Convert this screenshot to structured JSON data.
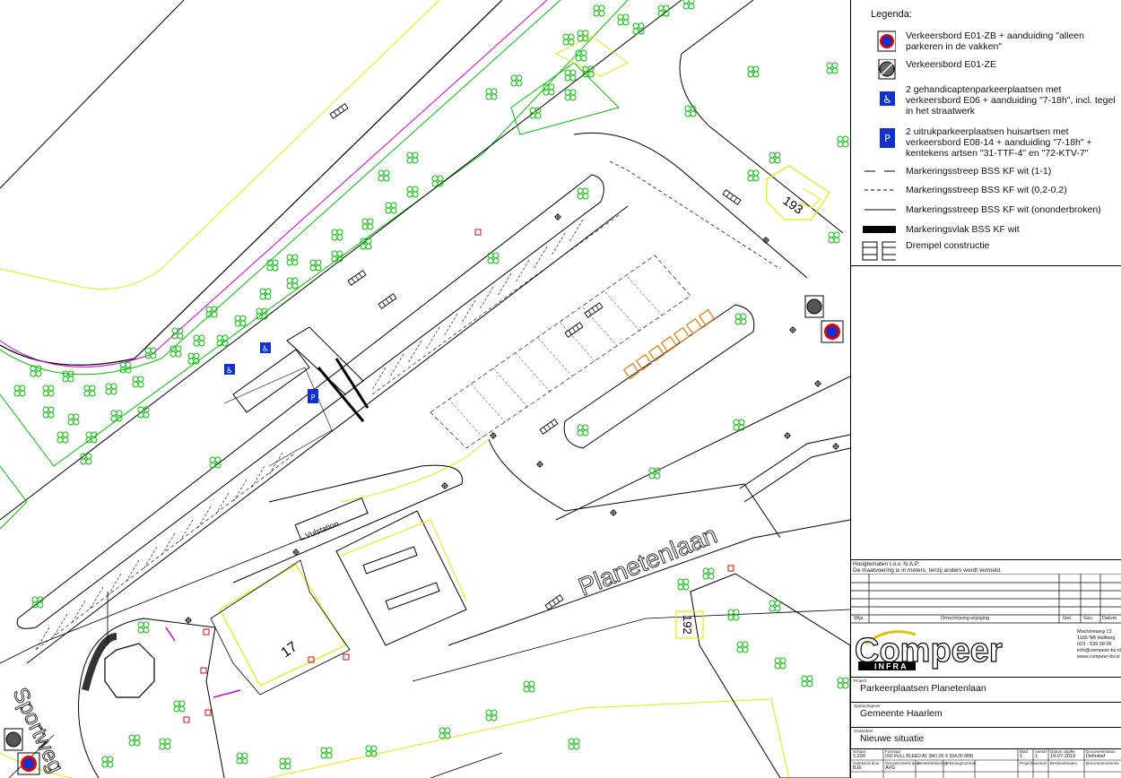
{
  "map": {
    "streets": [
      "Planetenlaan",
      "Sportweg"
    ],
    "labels": {
      "vulstation": "Vulstation",
      "house_17": "17",
      "house_192": "192",
      "house_193": "193"
    }
  },
  "legend": {
    "title": "Legenda:",
    "items": [
      {
        "icon": "no-parking-sign-icon",
        "text": "Verkeersbord E01-ZB + aanduiding \"alleen parkeren in de vakken\""
      },
      {
        "icon": "end-no-parking-sign-icon",
        "text": "Verkeersbord E01-ZE"
      },
      {
        "icon": "disabled-parking-sign-icon",
        "text": "2 gehandicaptenparkeerplaatsen met verkeersbord E06 + aanduiding \"7-18h\", incl. tegel in het straatwerk"
      },
      {
        "icon": "doctor-parking-sign-icon",
        "text": "2 uitrukparkeerplaatsen huisartsen met verkeersbord E08-14 + aanduiding \"7-18h\" + kentekens artsen \"31-TTF-4\" en \"72-KTV-7\""
      },
      {
        "icon": "dash-line-1-1-icon",
        "text": "Markeringsstreep BSS KF wit (1-1)"
      },
      {
        "icon": "dash-line-02-02-icon",
        "text": "Markeringsstreep BSS KF wit (0,2-0,2)"
      },
      {
        "icon": "solid-line-icon",
        "text": "Markeringsstreep BSS KF wit (ononderbroken)"
      },
      {
        "icon": "marking-area-icon",
        "text": "Markeringsvlak BSS KF wit"
      },
      {
        "icon": "threshold-icon",
        "text": "Drempel constructie"
      }
    ]
  },
  "notes": {
    "line1": "Hoogtematen t.o.v. N.A.P.",
    "line2": "De maatvoering is in meters, tenzij anders wordt vermeld."
  },
  "revision_table": {
    "col_wijz": "Wijz.",
    "col_desc": "Omschrijving wijziging",
    "col_get": "Get.",
    "col_gec": "Gec.",
    "col_datum": "Datum"
  },
  "company": {
    "name": "Compeer",
    "sub": "INFRA",
    "address1": "Machineweg 13",
    "address2": "1165 NB Halfweg",
    "phone": "023 - 539 38 06",
    "email": "info@compeer-bv.nl",
    "web": "www.compeer-bv.nl"
  },
  "titleblock": {
    "project_label": "Project",
    "project": "Parkeerplaatsen Planetenlaan",
    "client_label": "Opdrachtgever",
    "client": "Gemeente Haarlem",
    "subject_label": "Onderdeel",
    "subject": "Nieuwe situatie",
    "schaal_label": "Schaal",
    "schaal": "1:200",
    "formaat_label": "Formaat",
    "formaat": "ISO FULL BLEED A1 (841,00 X 594,00 MM)",
    "blad_label": "Blad",
    "blad": "1",
    "aantal_label": "Aantal",
    "aantal": "1",
    "datum_label": "Datum uitgifte",
    "datum": "10-07-2019",
    "status_label": "Documentstatus",
    "status": "Definitief",
    "getekend_label": "Getekend door",
    "getekend": "BJE",
    "gecontroleerd_label": "Gecontroleerd door",
    "gecontroleerd": "AVG",
    "bestek_label": "Bestekstekening",
    "tekening_label": "Tekeningnummer",
    "projectnr_label": "Projectnummer",
    "bestandsnaam_label": "Bestandsnaam",
    "documentnr_label": "Documentnummer"
  },
  "colors": {
    "road": "#000000",
    "green": "#00c000",
    "yellow": "#e8e800",
    "magenta": "#d000d0",
    "red": "#e00000",
    "orange": "#e08000",
    "blue": "#1030d0"
  }
}
